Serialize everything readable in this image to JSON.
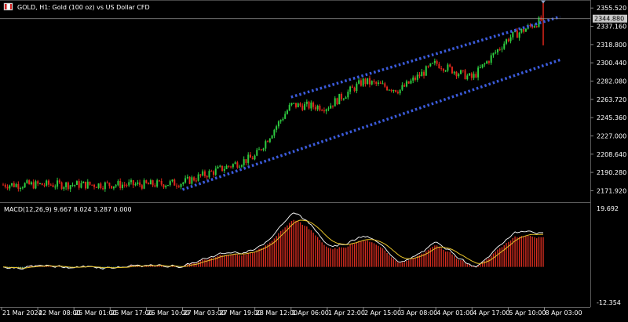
{
  "header": {
    "symbol_title": "GOLD, H1:  Gold (100 oz) vs US Dollar CFD"
  },
  "price_scale": {
    "labels": [
      "2355.520",
      "2337.160",
      "2318.800",
      "2300.440",
      "2282.080",
      "2263.720",
      "2245.360",
      "2227.000",
      "2208.640",
      "2190.280",
      "2171.920"
    ],
    "current_price": "2344.880"
  },
  "indicator": {
    "label": "MACD(12,26,9) 9.667 8.024 3.287 0.000",
    "scale_top": "19.692",
    "scale_bottom": "-12.354"
  },
  "time_axis": {
    "labels": [
      "21 Mar 2024",
      "22 Mar 08:00",
      "25 Mar 01:00",
      "25 Mar 17:00",
      "26 Mar 10:00",
      "27 Mar 03:00",
      "27 Mar 19:00",
      "28 Mar 12:00",
      "1 Apr 06:00",
      "1 Apr 22:00",
      "2 Apr 15:00",
      "3 Apr 08:00",
      "4 Apr 01:00",
      "4 Apr 17:00",
      "5 Apr 10:00",
      "8 Apr 03:00"
    ]
  },
  "colors": {
    "background": "#000000",
    "bull": "#2ecc40",
    "bear": "#e0261b",
    "channel": "#3b5bdb",
    "macd_line": "#ffffff",
    "signal_line": "#e6c229",
    "hist_pos": "#d62d20",
    "hist_neg": "#4fb3c8",
    "grid": "#3a3a3a",
    "price_tag_bg": "#c8c8c8"
  },
  "chart_data": {
    "type": "candlestick",
    "symbol": "GOLD",
    "timeframe": "H1",
    "y_range": [
      2162,
      2362
    ],
    "current_price": 2344.88,
    "key_closes": [
      {
        "t": "21 Mar 2024",
        "close": 2178
      },
      {
        "t": "26 Mar 10:00",
        "close": 2178
      },
      {
        "t": "27 Mar 03:00",
        "close": 2180
      },
      {
        "t": "28 Mar 12:00",
        "close": 2206
      },
      {
        "t": "1 Apr 06:00",
        "close": 2258
      },
      {
        "t": "1 Apr 22:00",
        "close": 2256
      },
      {
        "t": "2 Apr 15:00",
        "close": 2282
      },
      {
        "t": "3 Apr 08:00",
        "close": 2273
      },
      {
        "t": "4 Apr 01:00",
        "close": 2300
      },
      {
        "t": "4 Apr 17:00",
        "close": 2285
      },
      {
        "t": "5 Apr 10:00",
        "close": 2325
      },
      {
        "t": "8 Apr 03:00",
        "close": 2344.88
      }
    ],
    "channel": {
      "upper": [
        {
          "t": "1 Apr 06:00",
          "price": 2266
        },
        {
          "t": "8 Apr 03:00",
          "price": 2342
        }
      ],
      "lower": [
        {
          "t": "27 Mar 03:00",
          "price": 2173
        },
        {
          "t": "8 Apr 03:00",
          "price": 2298
        }
      ]
    },
    "macd": {
      "fast": 12,
      "slow": 26,
      "signal": 9,
      "macd": 9.667,
      "signal_value": 8.024,
      "histogram": 3.287,
      "level": 0.0,
      "range": [
        -12.354,
        19.692
      ]
    }
  }
}
